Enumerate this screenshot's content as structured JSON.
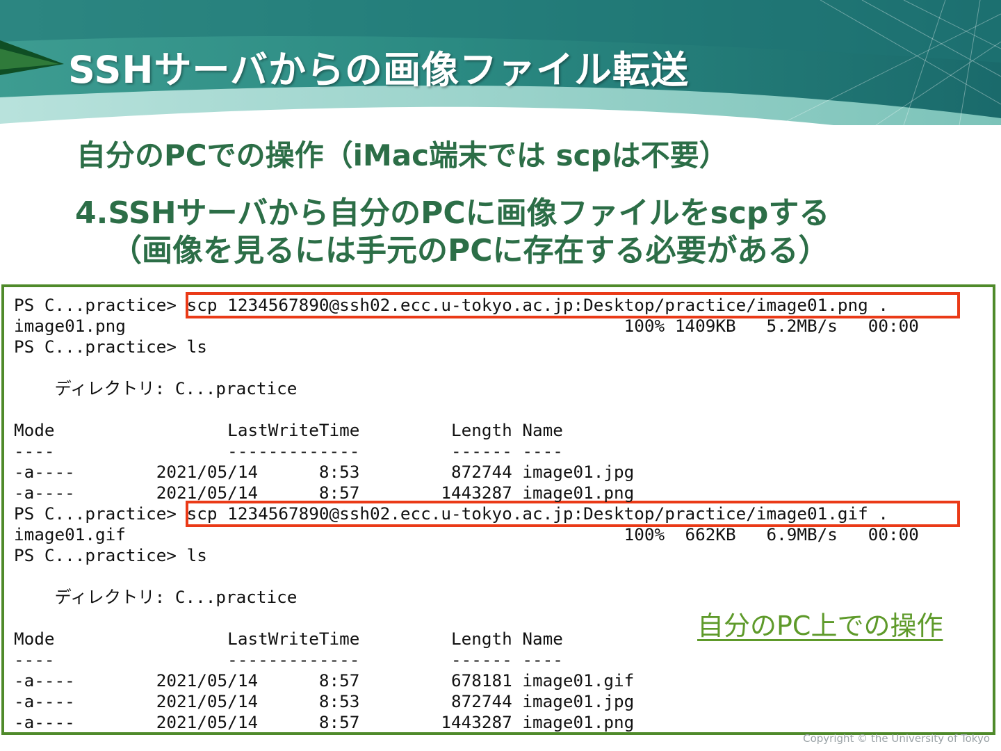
{
  "slide": {
    "title": "SSHサーバからの画像ファイル転送",
    "heading1": "自分のPCでの操作（iMac端末では scpは不要）",
    "heading2": "4.SSHサーバから自分のPCに画像ファイルをscpする",
    "heading3": "（画像を見るには手元のPCに存在する必要がある）",
    "annotation": "自分のPC上での操作",
    "copyright": "Copyright © the University of Tokyo"
  },
  "terminal": {
    "lines": [
      "PS C...practice> scp 1234567890@ssh02.ecc.u-tokyo.ac.jp:Desktop/practice/image01.png .",
      "image01.png                                                 100% 1409KB   5.2MB/s   00:00",
      "PS C...practice> ls",
      "",
      "    ディレクトリ: C...practice",
      "",
      "Mode                 LastWriteTime         Length Name",
      "----                 -------------         ------ ----",
      "-a----        2021/05/14      8:53         872744 image01.jpg",
      "-a----        2021/05/14      8:57        1443287 image01.png",
      "PS C...practice> scp 1234567890@ssh02.ecc.u-tokyo.ac.jp:Desktop/practice/image01.gif .",
      "image01.gif                                                 100%  662KB   6.9MB/s   00:00",
      "PS C...practice> ls",
      "",
      "    ディレクトリ: C...practice",
      "",
      "Mode                 LastWriteTime         Length Name",
      "----                 -------------         ------ ----",
      "-a----        2021/05/14      8:57         678181 image01.gif",
      "-a----        2021/05/14      8:53         872744 image01.jpg",
      "-a----        2021/05/14      8:57        1443287 image01.png"
    ]
  },
  "colors": {
    "title_text": "#ffffff",
    "heading_text": "#2c6e47",
    "terminal_border": "#4f8a2a",
    "highlight_border": "#ea3a17",
    "annotation_text": "#5e9a2a",
    "header_teal_dark": "#1d6b6b",
    "header_teal_light": "#9fd3cc"
  }
}
